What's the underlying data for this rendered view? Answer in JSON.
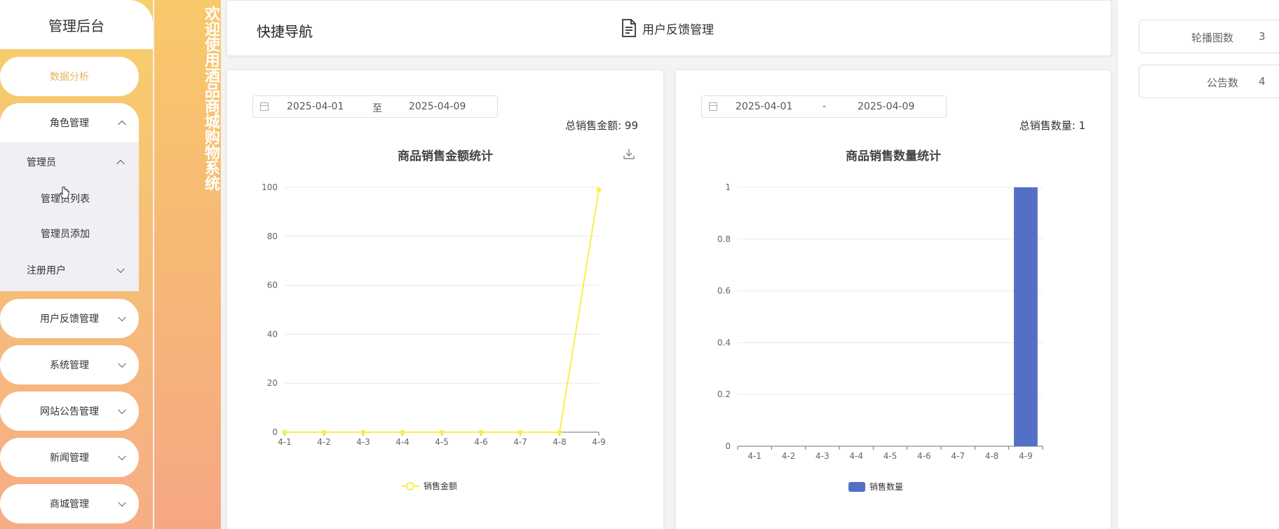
{
  "sidebar": {
    "title": "管理后台",
    "items": [
      {
        "label": "数据分析"
      },
      {
        "label": "角色管理"
      },
      {
        "label": "用户反馈管理"
      },
      {
        "label": "系统管理"
      },
      {
        "label": "网站公告管理"
      },
      {
        "label": "新闻管理"
      },
      {
        "label": "商城管理"
      }
    ],
    "submenu": {
      "group1": "管理员",
      "item1": "管理员列表",
      "item2": "管理员添加",
      "group2": "注册用户"
    }
  },
  "welcome": "欢迎使用酒品商城购物系统",
  "quick_nav": {
    "title": "快捷导航",
    "link": "用户反馈管理"
  },
  "sales_amount": {
    "date_start": "2025-04-01",
    "date_sep": "至",
    "date_end": "2025-04-09",
    "total_label": "总销售金额:",
    "total_value": "99"
  },
  "sales_count": {
    "date_start": "2025-04-01",
    "date_sep": "-",
    "date_end": "2025-04-09",
    "total_label": "总销售数量:",
    "total_value": "1"
  },
  "stats": {
    "carousel_label": "轮播图数",
    "carousel_value": "3",
    "notice_label": "公告数",
    "notice_value": "4"
  },
  "colors": {
    "line": "#f8ee4e",
    "bar": "#5470c6",
    "accent": "#e7b45f"
  },
  "chart_data": [
    {
      "type": "line",
      "title": "商品销售金额统计",
      "categories": [
        "4-1",
        "4-2",
        "4-3",
        "4-4",
        "4-5",
        "4-6",
        "4-7",
        "4-8",
        "4-9"
      ],
      "series": [
        {
          "name": "销售金额",
          "values": [
            0,
            0,
            0,
            0,
            0,
            0,
            0,
            0,
            99
          ]
        }
      ],
      "ylim": [
        0,
        100
      ],
      "yticks": [
        0,
        20,
        40,
        60,
        80,
        100
      ],
      "grid": true,
      "legend": "bottom-center"
    },
    {
      "type": "bar",
      "title": "商品销售数量统计",
      "categories": [
        "4-1",
        "4-2",
        "4-3",
        "4-4",
        "4-5",
        "4-6",
        "4-7",
        "4-8",
        "4-9"
      ],
      "series": [
        {
          "name": "销售数量",
          "values": [
            0,
            0,
            0,
            0,
            0,
            0,
            0,
            0,
            1
          ]
        }
      ],
      "ylim": [
        0,
        1
      ],
      "yticks": [
        0,
        0.2,
        0.4,
        0.6,
        0.8,
        1
      ],
      "grid": true,
      "legend": "bottom-center"
    }
  ]
}
